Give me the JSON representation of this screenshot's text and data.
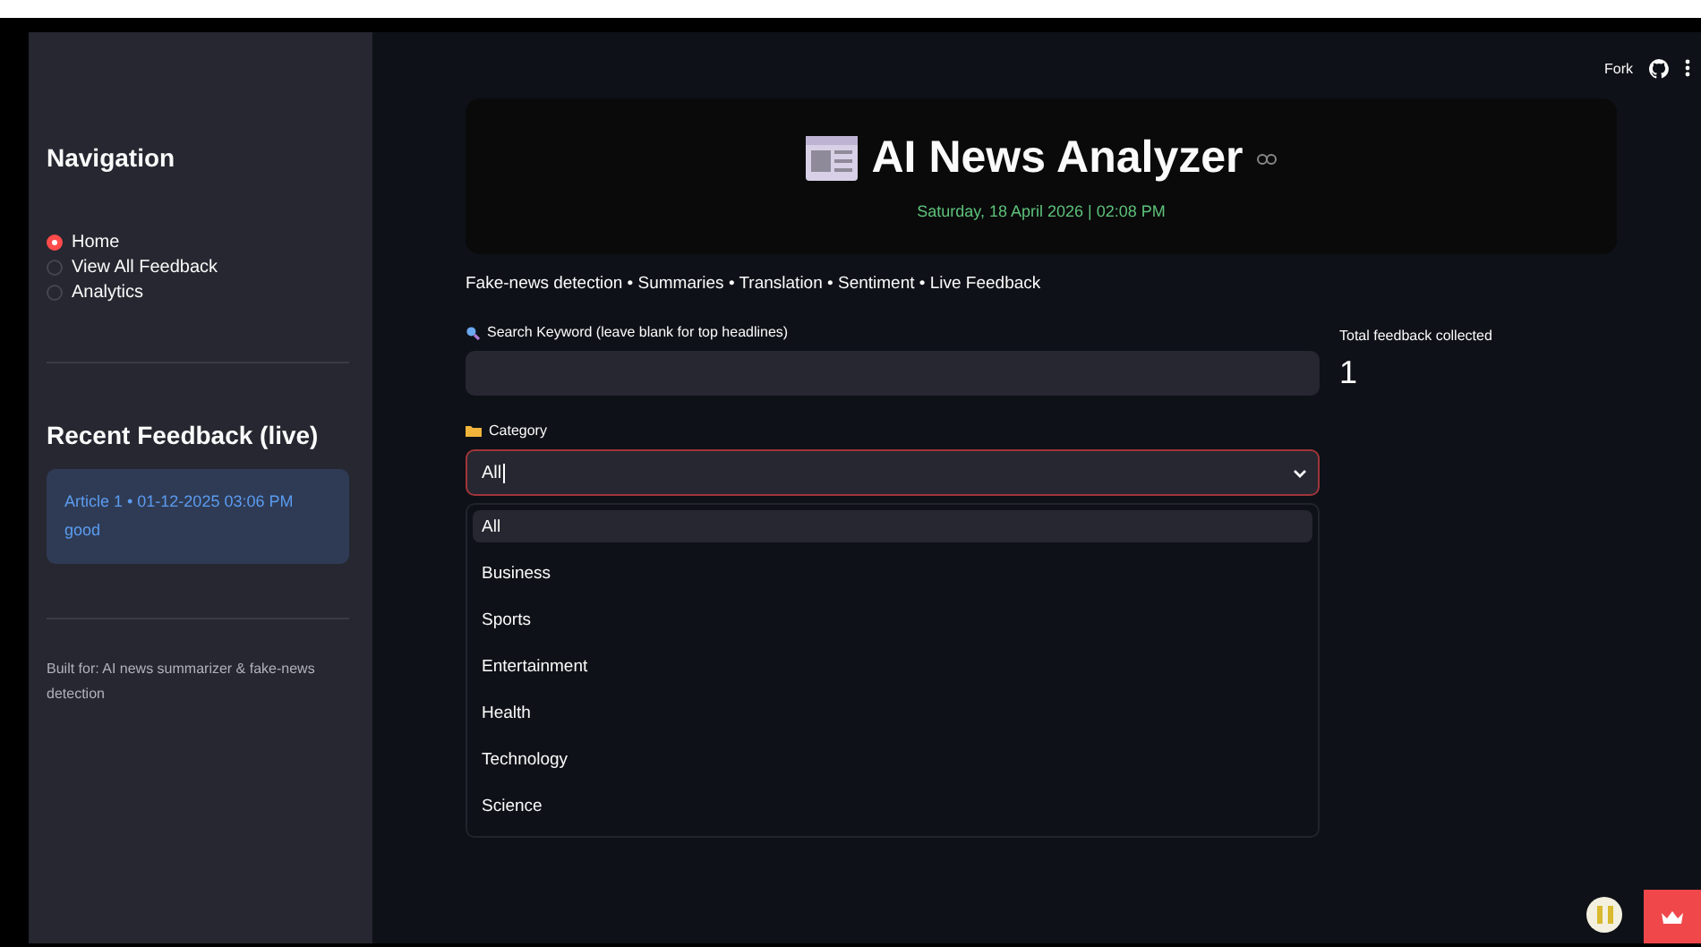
{
  "sidebar": {
    "nav_title": "Navigation",
    "nav_items": [
      {
        "label": "Home",
        "selected": true
      },
      {
        "label": "View All Feedback",
        "selected": false
      },
      {
        "label": "Analytics",
        "selected": false
      }
    ],
    "recent_title": "Recent Feedback (live)",
    "recent_feedback": [
      {
        "meta": "Article 1 • 01-12-2025 03:06 PM",
        "text": "good"
      }
    ],
    "footer": "Built for: AI news summarizer & fake-news detection"
  },
  "toolbar": {
    "fork": "Fork"
  },
  "header": {
    "title": "AI News Analyzer",
    "datetime": "Saturday, 18 April 2026 | 02:08 PM"
  },
  "tagline": "Fake-news detection • Summaries • Translation • Sentiment • Live Feedback",
  "search": {
    "label": "Search Keyword (leave blank for top headlines)"
  },
  "category": {
    "label": "Category",
    "value": "All",
    "options": [
      {
        "label": "All",
        "selected": true
      },
      {
        "label": "Business",
        "selected": false
      },
      {
        "label": "Sports",
        "selected": false
      },
      {
        "label": "Entertainment",
        "selected": false
      },
      {
        "label": "Health",
        "selected": false
      },
      {
        "label": "Technology",
        "selected": false
      },
      {
        "label": "Science",
        "selected": false
      }
    ]
  },
  "metric": {
    "label": "Total feedback collected",
    "value": "1"
  }
}
